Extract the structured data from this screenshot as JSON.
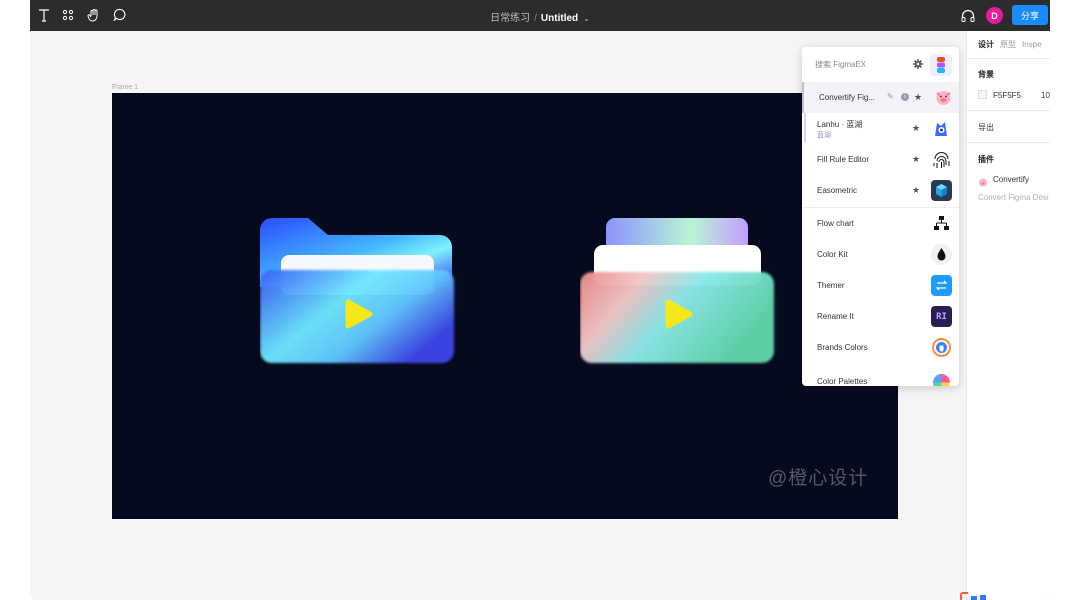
{
  "toolbar": {
    "tools": [
      "text-tool",
      "components-tool",
      "hand-tool",
      "comment-tool"
    ],
    "project": "日常练习",
    "separator": "/",
    "file_name": "Untitled",
    "avatar_initial": "D",
    "share_label": "分享"
  },
  "canvas": {
    "frame_label": "Frame 1",
    "frame_color": "#060a1e",
    "watermark": "@橙心设计"
  },
  "properties_panel": {
    "tabs": [
      "设计",
      "原型",
      "Inspe"
    ],
    "background_heading": "背景",
    "background_color": "F5F5F5",
    "background_opacity": "10",
    "export_heading": "导出",
    "plugins_heading": "插件",
    "plugin_name": "Convertify",
    "plugin_desc": "Convert Figma Desi"
  },
  "plugin_popup": {
    "search_placeholder": "搜索 FigmaEX",
    "items": [
      {
        "label": "Convertify Fig...",
        "starred": true,
        "icon": "pig-icon"
      },
      {
        "label": "Lanhu · 蓝湖",
        "sub": "蓝湖",
        "starred": true,
        "icon": "lanhu-icon"
      },
      {
        "label": "Fill Rule Editor",
        "starred": true,
        "icon": "fingerprint-icon"
      },
      {
        "label": "Easometric",
        "starred": true,
        "icon": "cube-icon"
      },
      {
        "label": "Flow chart",
        "starred": false,
        "icon": "flowchart-icon"
      },
      {
        "label": "Color Kit",
        "starred": false,
        "icon": "drop-icon"
      },
      {
        "label": "Themer",
        "starred": false,
        "icon": "swap-icon"
      },
      {
        "label": "Rename It",
        "starred": false,
        "icon": "rename-icon"
      },
      {
        "label": "Brands Colors",
        "starred": false,
        "icon": "brand-icon"
      },
      {
        "label": "Color Palettes",
        "starred": false,
        "icon": "palette-icon"
      }
    ]
  },
  "colors": {
    "accent": "#1a8cff",
    "avatar": "#e71c9c",
    "toolbar": "#2c2c2c"
  }
}
